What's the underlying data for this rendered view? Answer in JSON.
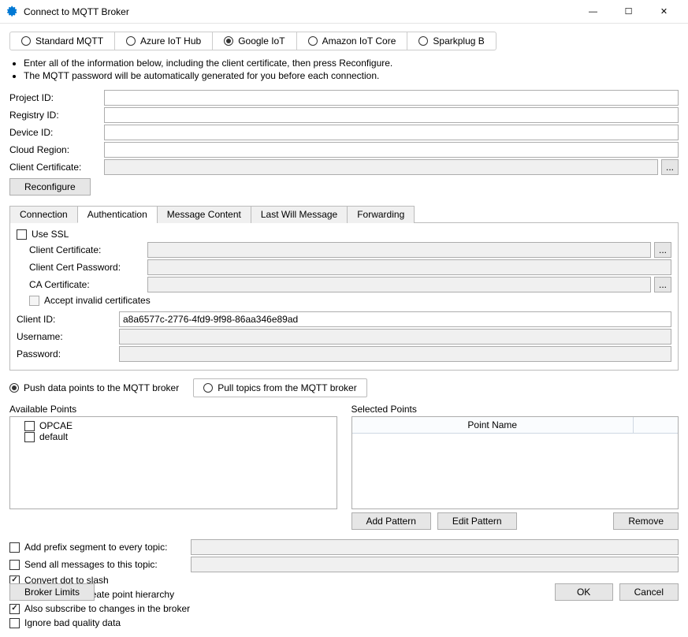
{
  "window": {
    "title": "Connect to MQTT Broker"
  },
  "broker_tabs": {
    "standard": "Standard MQTT",
    "azure": "Azure IoT Hub",
    "google": "Google IoT",
    "amazon": "Amazon IoT Core",
    "sparkplug": "Sparkplug B",
    "selected": "google"
  },
  "info": {
    "line1": "Enter all of the information below, including the client certificate, then press Reconfigure.",
    "line2": "The MQTT password will be automatically generated for you before each connection."
  },
  "fields": {
    "project_id_label": "Project ID:",
    "project_id": "",
    "registry_id_label": "Registry ID:",
    "registry_id": "",
    "device_id_label": "Device ID:",
    "device_id": "",
    "cloud_region_label": "Cloud Region:",
    "cloud_region": "",
    "client_cert_label": "Client Certificate:",
    "client_cert": "",
    "reconfigure": "Reconfigure",
    "browse": "..."
  },
  "subtabs": {
    "connection": "Connection",
    "authentication": "Authentication",
    "message_content": "Message Content",
    "last_will": "Last Will Message",
    "forwarding": "Forwarding"
  },
  "auth": {
    "use_ssl": "Use SSL",
    "client_cert_label": "Client Certificate:",
    "client_cert": "",
    "client_cert_pw_label": "Client Cert Password:",
    "client_cert_pw": "",
    "ca_cert_label": "CA Certificate:",
    "ca_cert": "",
    "accept_invalid": "Accept invalid certificates",
    "client_id_label": "Client ID:",
    "client_id": "a8a6577c-2776-4fd9-9f98-86aa346e89ad",
    "username_label": "Username:",
    "username": "",
    "password_label": "Password:",
    "password": ""
  },
  "mode": {
    "push": "Push data points to the MQTT broker",
    "pull": "Pull topics from the MQTT broker"
  },
  "points": {
    "available_title": "Available Points",
    "selected_title": "Selected Points",
    "col_point_name": "Point Name",
    "items": [
      "OPCAE",
      "default"
    ],
    "add_pattern": "Add Pattern",
    "edit_pattern": "Edit Pattern",
    "remove": "Remove"
  },
  "options": {
    "add_prefix": "Add prefix segment to every topic:",
    "send_all": "Send all messages to this topic:",
    "convert_dot": "Convert dot to slash",
    "auto_hierarchy": "Automatically create point hierarchy",
    "also_subscribe": "Also subscribe to changes in the broker",
    "ignore_bad": "Ignore bad quality data",
    "prefix_value": "",
    "send_all_value": ""
  },
  "footer": {
    "broker_limits": "Broker Limits",
    "ok": "OK",
    "cancel": "Cancel"
  }
}
